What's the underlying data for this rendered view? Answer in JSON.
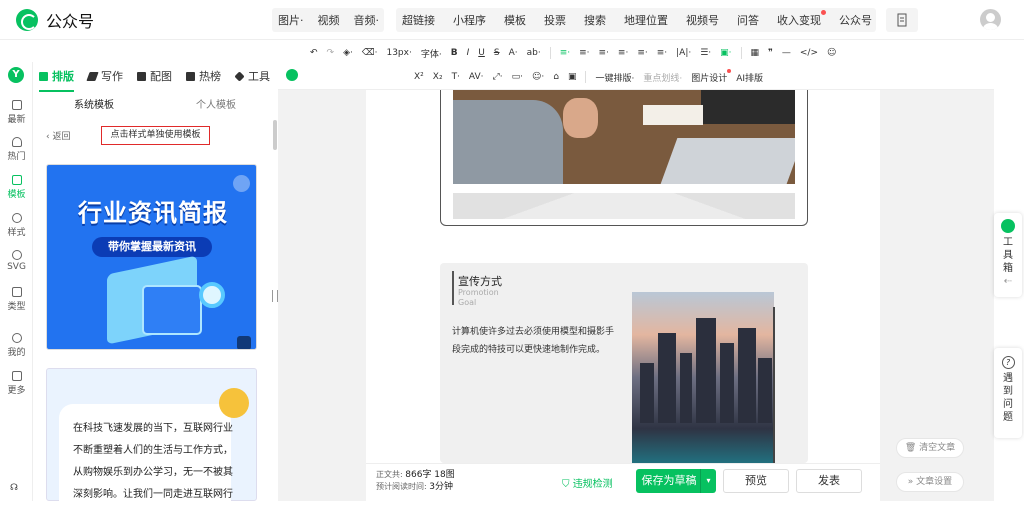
{
  "app": {
    "title": "公众号"
  },
  "topnav": {
    "group1": [
      "图片·",
      "视频",
      "音频·"
    ],
    "group2": [
      "超链接",
      "小程序",
      "模板",
      "投票",
      "搜索",
      "地理位置",
      "视频号",
      "问答",
      "收入变现",
      "公众号",
      "···"
    ]
  },
  "editor_tabs": {
    "items": [
      {
        "label": "排版",
        "icon": "layout-icon"
      },
      {
        "label": "写作",
        "icon": "pen-icon"
      },
      {
        "label": "配图",
        "icon": "image-icon"
      },
      {
        "label": "热榜",
        "icon": "bookmark-icon"
      },
      {
        "label": "工具",
        "icon": "cube-icon"
      }
    ]
  },
  "rail": {
    "items": [
      {
        "label": "最新",
        "icon": "new-icon"
      },
      {
        "label": "热门",
        "icon": "fire-icon"
      },
      {
        "label": "模板",
        "icon": "template-icon"
      },
      {
        "label": "样式",
        "icon": "style-icon"
      },
      {
        "label": "SVG",
        "icon": "svg-icon"
      },
      {
        "label": "类型",
        "icon": "type-icon"
      },
      {
        "label": "我的",
        "icon": "user-icon"
      },
      {
        "label": "更多",
        "icon": "grid-icon"
      }
    ],
    "bottom_icon": "headset-icon"
  },
  "template_panel": {
    "tabs": [
      "系统模板",
      "个人模板"
    ],
    "back_label": "返回",
    "hint": "点击样式单独使用模板",
    "card1": {
      "title": "行业资讯简报",
      "subtitle": "带你掌握最新资讯"
    },
    "card2": {
      "text": "在科技飞速发展的当下，互联网行业不断重塑着人们的生活与工作方式，从购物娱乐到办公学习，无一不被其深刻影响。让我们一同走进互联网行"
    }
  },
  "toolbar": {
    "row1": [
      "13px·",
      "字体·",
      "B",
      "I",
      "U",
      "S",
      "A·",
      "ab·",
      "≡·",
      "≡·",
      "≡·",
      "≡·",
      "≡·",
      "≡·",
      "|A|·",
      "☰·",
      "▣·",
      "▦",
      "❞",
      "—",
      "</>",
      "☺"
    ],
    "row2": [
      "X²",
      "X₂",
      "T·",
      "AV·",
      "⤢·",
      "▭·",
      "☺·",
      "⌂",
      "▣",
      "一键排版·",
      "重点划线·",
      "图片设计",
      "AI排版"
    ]
  },
  "document": {
    "section_title": "宣传方式",
    "section_en_1": "Promotion",
    "section_en_2": "Goal",
    "section_body": "计算机使许多过去必须使用模型和摄影手段完成的特技可以更快速地制作完成。"
  },
  "status": {
    "word_count_label": "正文共:",
    "word_count_value": "866字 18图",
    "reading_time_label": "预计阅读时间:",
    "reading_time_value": "3分钟",
    "check_label": "违规检测",
    "save_label": "保存为草稿",
    "preview_label": "预览",
    "publish_label": "发表"
  },
  "right": {
    "toolbox_label": "工具箱",
    "help_label": "遇到问题",
    "clear_label": "清空文章",
    "settings_label": "文章设置"
  }
}
